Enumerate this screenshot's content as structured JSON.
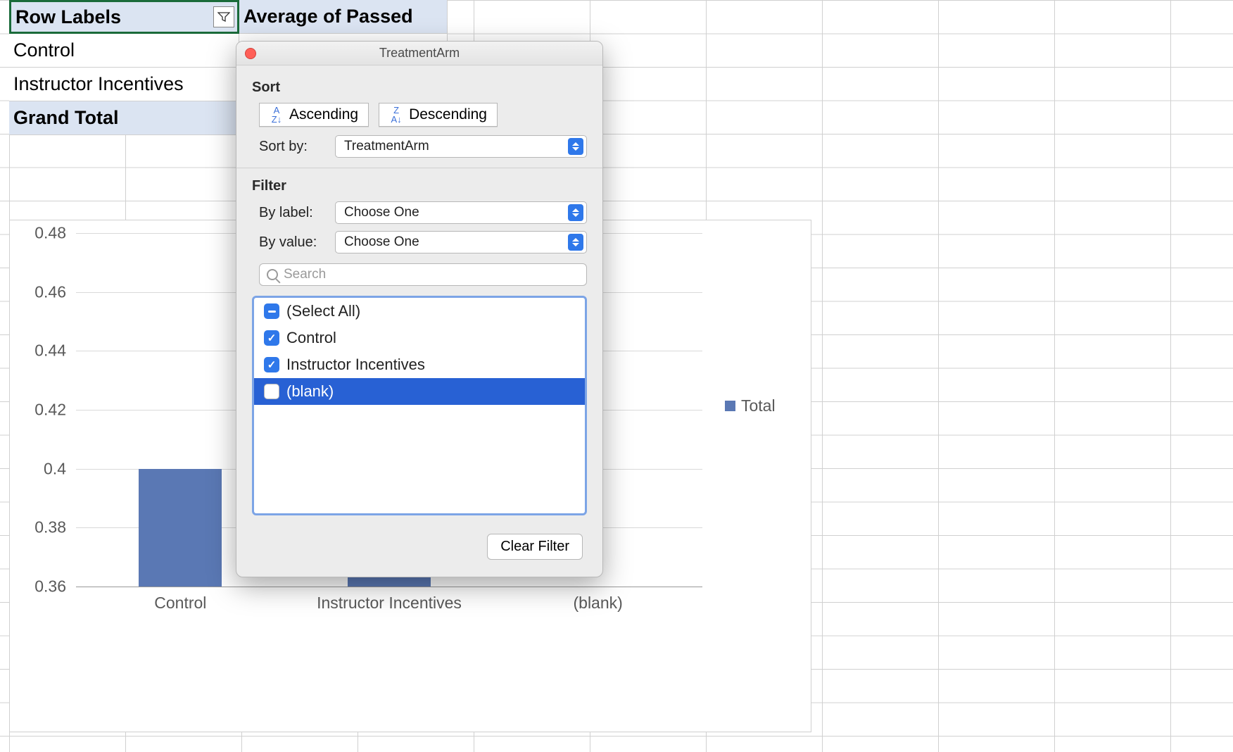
{
  "pivot": {
    "row_labels_header": "Row Labels",
    "avg_header": "Average of Passed",
    "rows": [
      "Control",
      "Instructor Incentives"
    ],
    "grand_total": "Grand Total"
  },
  "popover": {
    "title": "TreatmentArm",
    "sort_label": "Sort",
    "ascending": "Ascending",
    "descending": "Descending",
    "sort_by_label": "Sort by:",
    "sort_by_value": "TreatmentArm",
    "filter_label": "Filter",
    "by_label_label": "By label:",
    "by_label_value": "Choose One",
    "by_value_label": "By value:",
    "by_value_value": "Choose One",
    "search_placeholder": "Search",
    "items": [
      {
        "label": "(Select All)",
        "state": "mixed",
        "selected": false
      },
      {
        "label": "Control",
        "state": "checked",
        "selected": false
      },
      {
        "label": "Instructor Incentives",
        "state": "checked",
        "selected": false
      },
      {
        "label": "(blank)",
        "state": "unchecked",
        "selected": true
      }
    ],
    "clear_filter": "Clear Filter"
  },
  "chart_data": {
    "type": "bar",
    "categories": [
      "Control",
      "Instructor Incentives",
      "(blank)"
    ],
    "values": [
      0.4,
      0.387,
      null
    ],
    "legend": "Total",
    "ylim": [
      0.36,
      0.48
    ],
    "yticks": [
      0.36,
      0.38,
      0.4,
      0.42,
      0.44,
      0.46,
      0.48
    ]
  }
}
